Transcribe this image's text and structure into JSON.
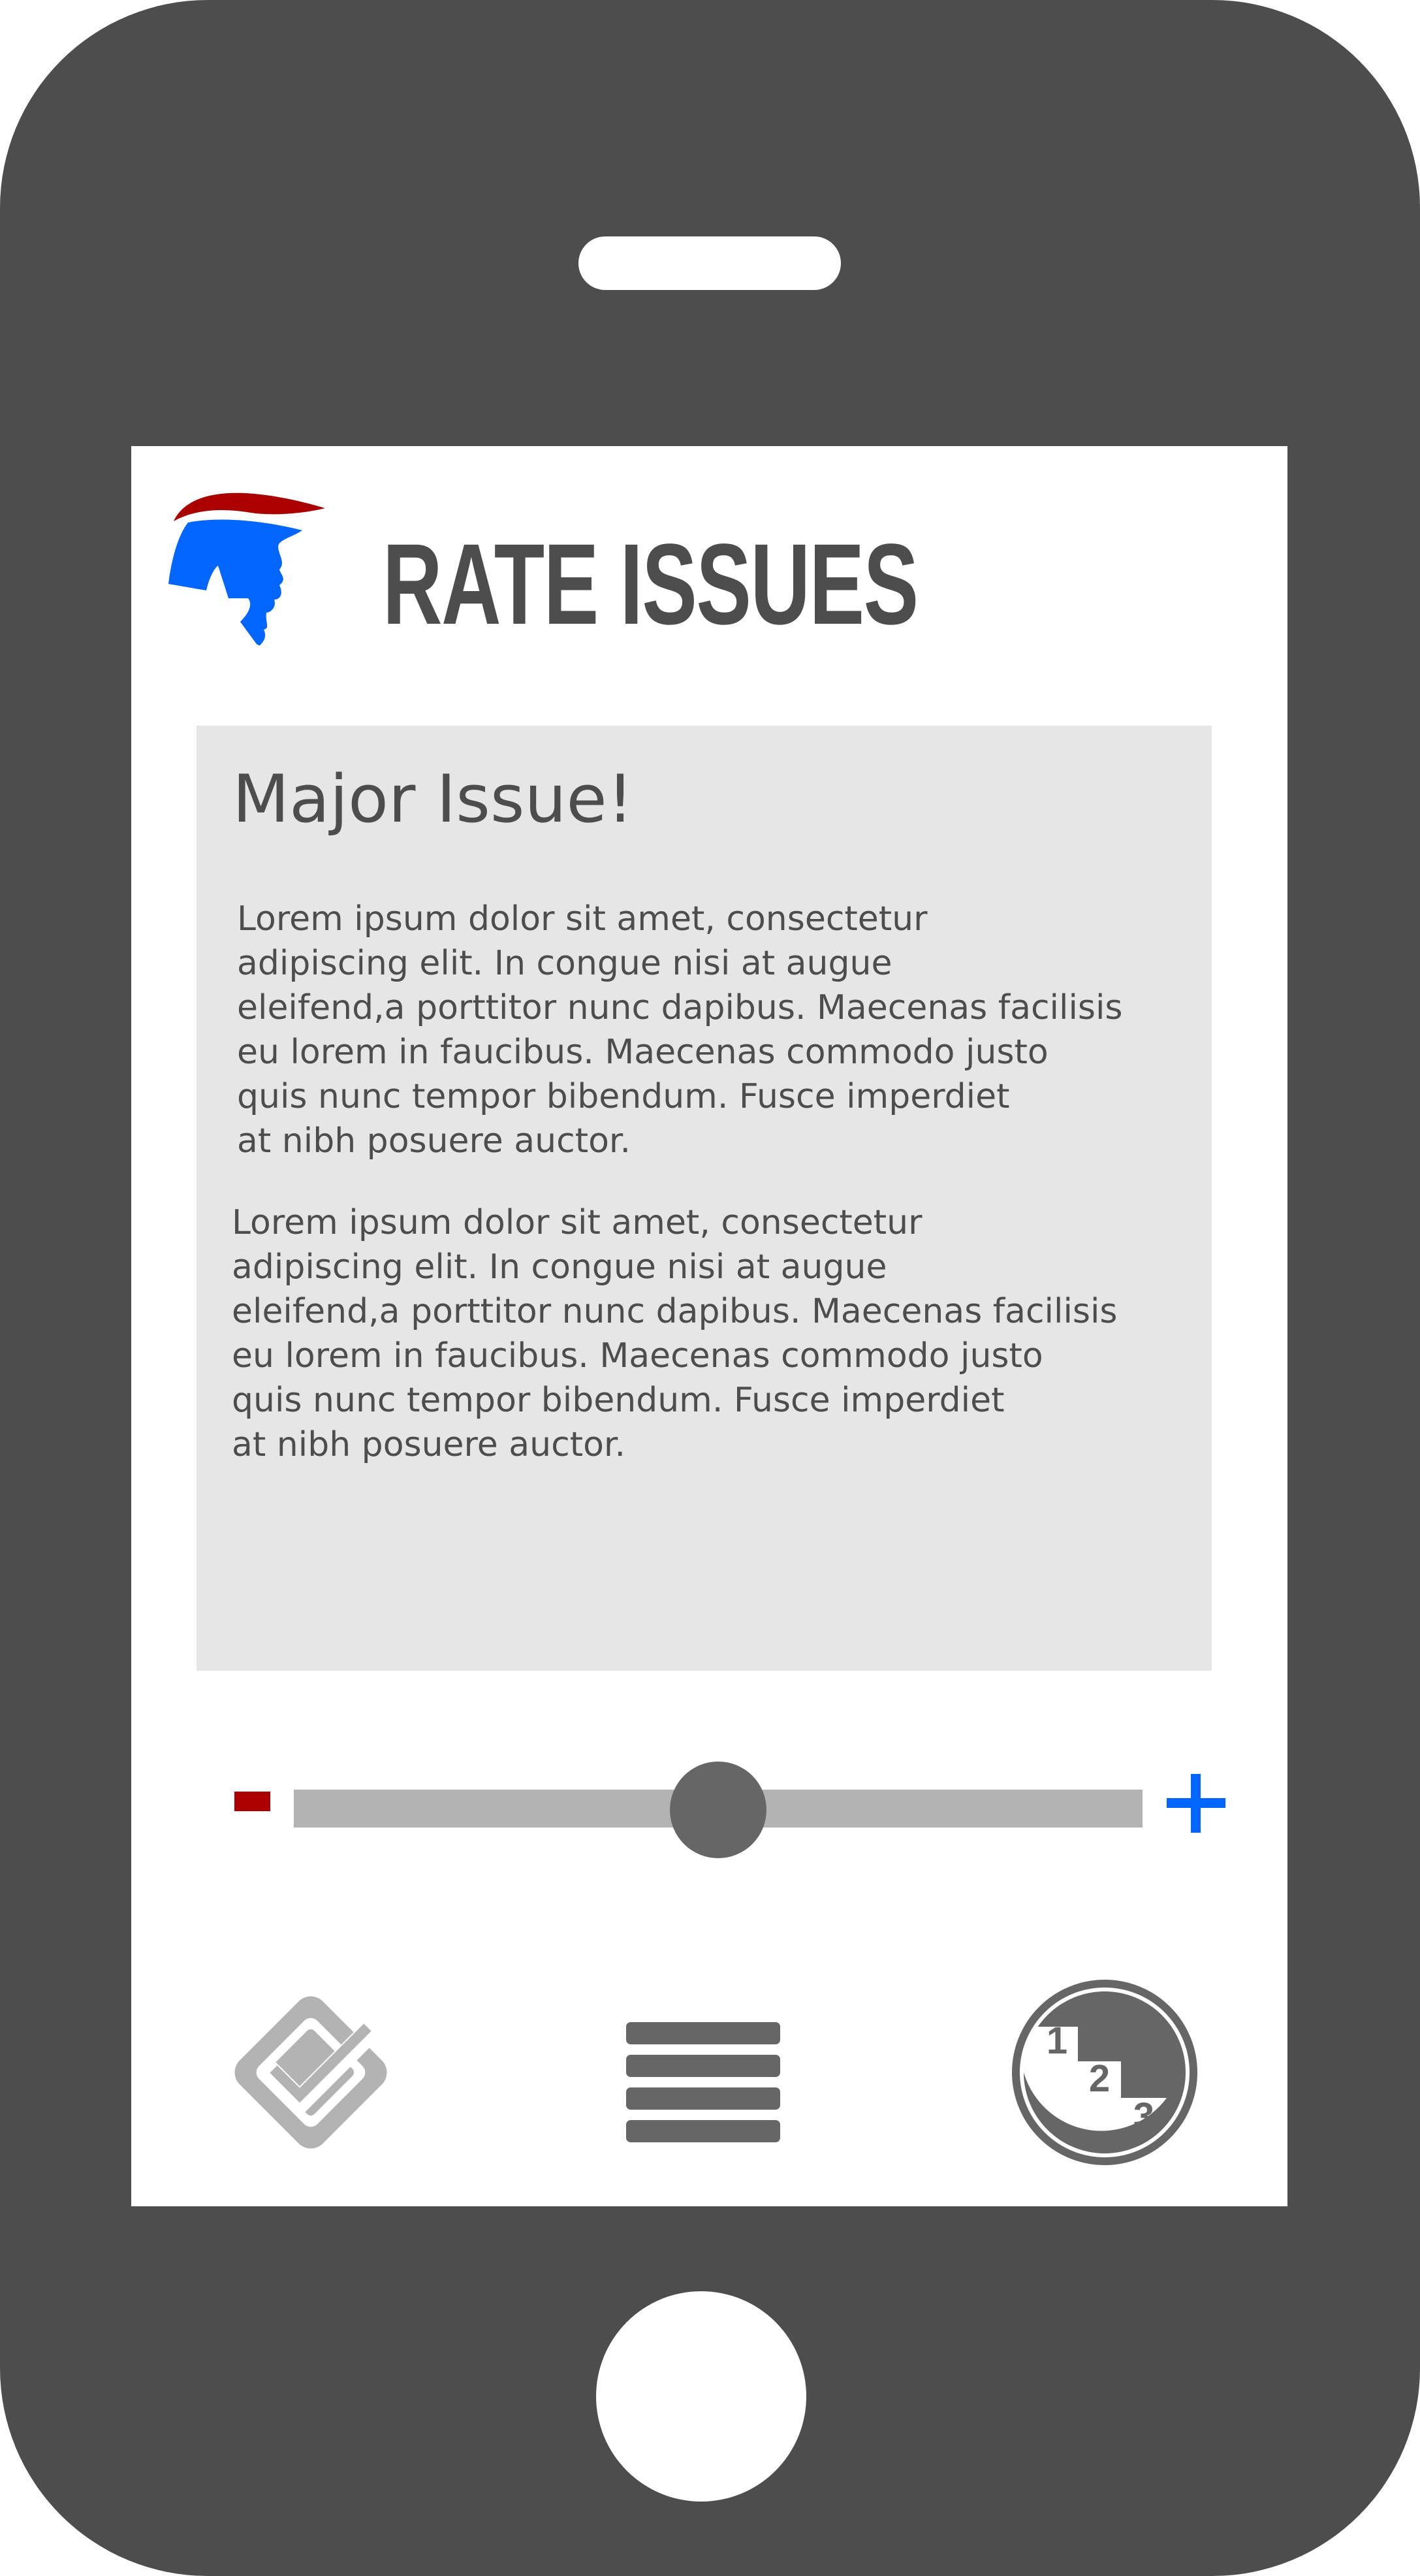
{
  "header": {
    "title": "RATE ISSUES",
    "logo": "profile-head-logo"
  },
  "card": {
    "heading": "Major Issue!",
    "paragraphs": [
      "Lorem ipsum dolor sit amet, consectetur\nadipiscing elit. In congue nisi at augue\neleifend,a porttitor nunc dapibus. Maecenas facilisis\neu lorem in faucibus. Maecenas commodo justo\nquis nunc tempor bibendum. Fusce imperdiet\nat nibh posuere auctor.",
      "Lorem ipsum dolor sit amet, consectetur\nadipiscing elit. In congue nisi at augue\neleifend,a porttitor nunc dapibus. Maecenas facilisis\neu lorem in faucibus. Maecenas commodo justo\nquis nunc tempor bibendum. Fusce imperdiet\nat nibh posuere auctor."
    ]
  },
  "slider": {
    "value_fraction": 0.5,
    "decrease_icon": "minus-icon",
    "increase_icon": "plus-icon"
  },
  "nav": {
    "items": [
      {
        "icon": "double-check-icon"
      },
      {
        "icon": "list-menu-icon"
      },
      {
        "icon": "ranking-podium-icon",
        "numbers": [
          "1",
          "2",
          "3"
        ]
      }
    ]
  },
  "colors": {
    "device": "#4d4d4d",
    "text": "#4d4d4d",
    "card_background": "#e6e6e6",
    "accent_red": "#aa0000",
    "accent_blue": "#0066ff",
    "slider_track": "#b3b3b3",
    "slider_thumb": "#666666"
  }
}
